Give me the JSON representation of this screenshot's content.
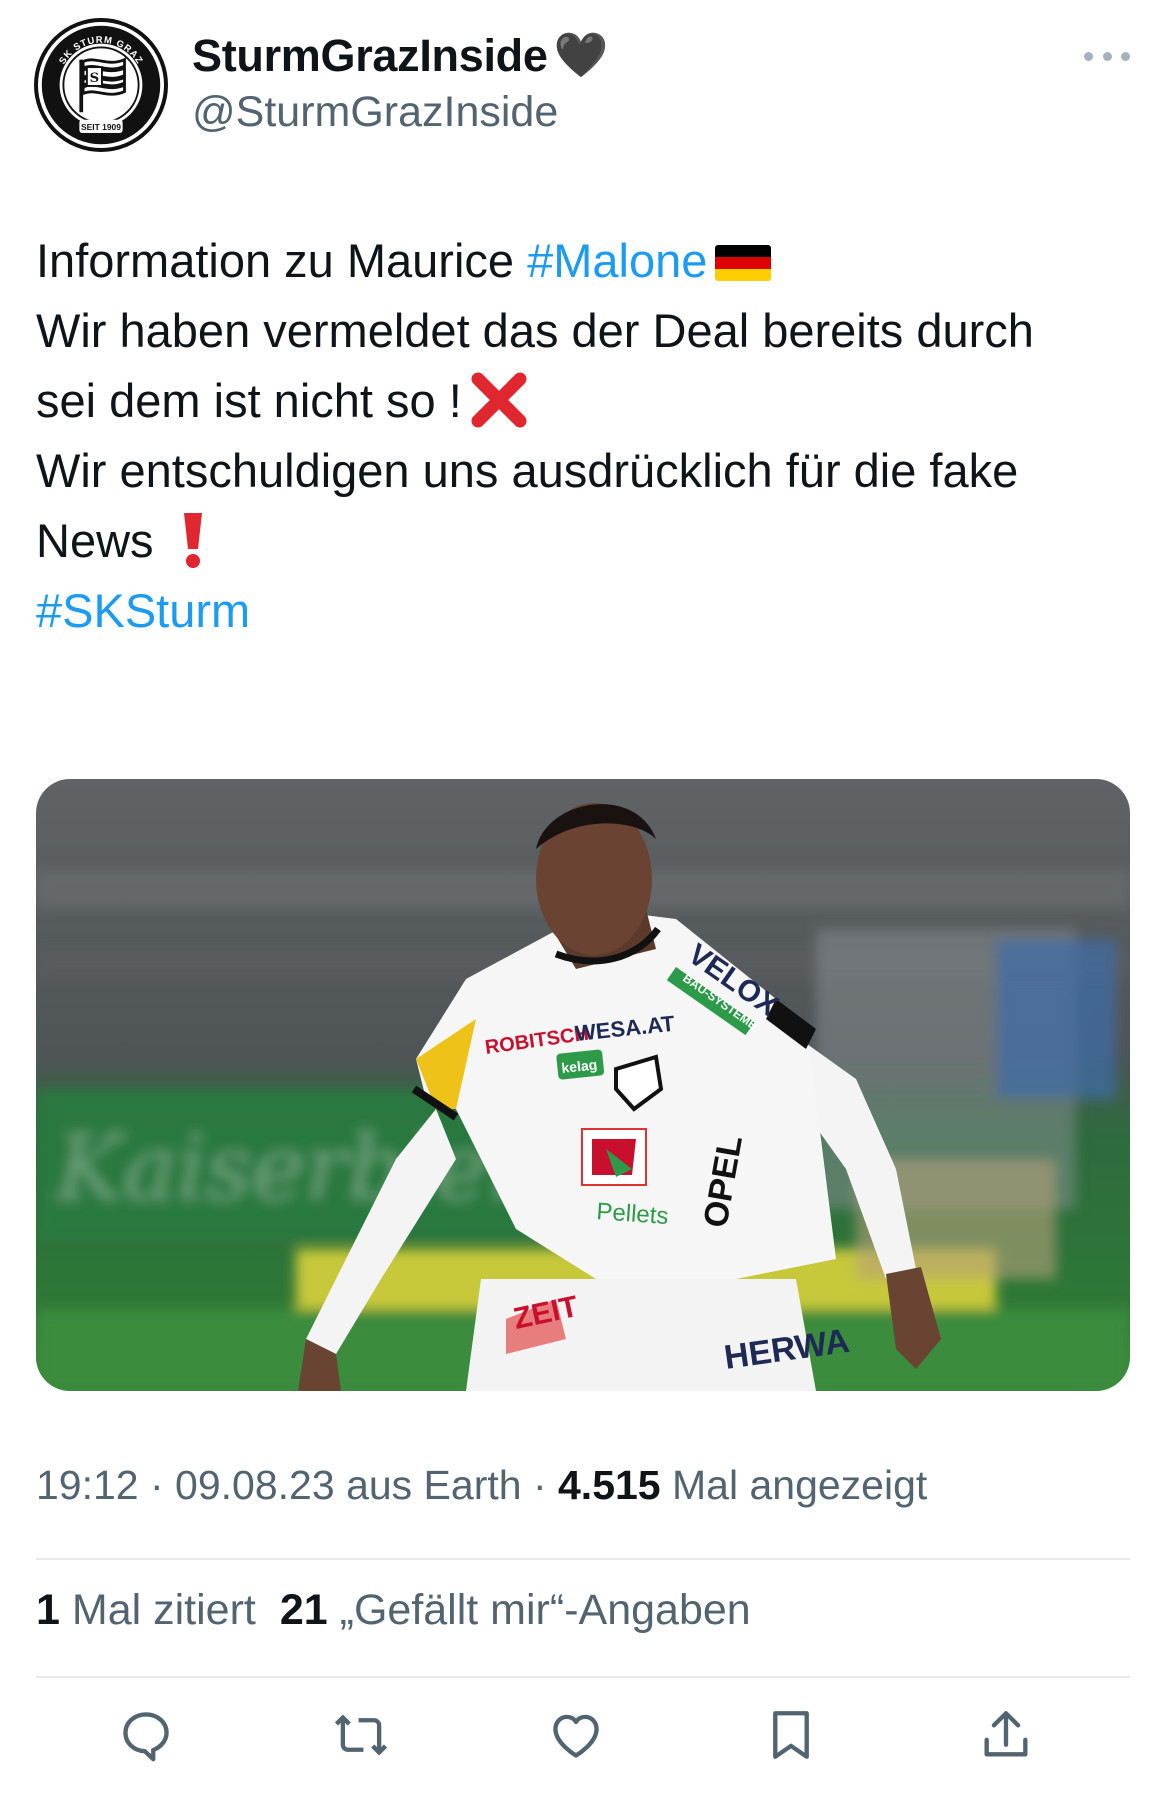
{
  "header": {
    "display_name": "SturmGrazInside",
    "name_emoji": "🖤",
    "handle": "@SturmGrazInside",
    "avatar_icon": "sk-sturm-graz-crest-icon",
    "avatar_crest_text_top": "SK STURM GRAZ",
    "avatar_crest_text_bottom": "SEIT 1909",
    "more_icon": "more-dots-icon"
  },
  "tweet": {
    "line1_text": "Information zu Maurice ",
    "line1_hashtag": "#Malone",
    "line1_emoji": "german-flag",
    "line2_text": "Wir haben vermeldet das der Deal bereits durch",
    "line3_text": "sei dem ist nicht so !",
    "line3_emoji": "cross-mark",
    "line4_text": "Wir entschuldigen uns ausdrücklich für die fake",
    "line5_text": "News",
    "line5_emoji": "exclamation-mark",
    "line6_hashtag": "#SKSturm"
  },
  "media": {
    "jersey_sponsors": [
      "ROBITSCH",
      "WESA.AT",
      "VELOX",
      "BAU-SYSTEME",
      "kelag",
      "Pellets",
      "OPEL",
      "HERWA",
      "ZEIT"
    ]
  },
  "meta": {
    "time": "19:12",
    "date": "09.08.23",
    "source": "aus Earth",
    "views_count": "4.515",
    "views_label": "Mal angezeigt",
    "separator": " · "
  },
  "stats": {
    "quotes_count": "1",
    "quotes_label": "Mal zitiert",
    "likes_count": "21",
    "likes_label": "„Gefällt mir“-Angaben"
  },
  "actions": {
    "icons": [
      "reply-icon",
      "retweet-icon",
      "like-icon",
      "bookmark-icon",
      "share-icon"
    ]
  },
  "colors": {
    "text": "#0f1419",
    "secondary": "#536471",
    "link": "#1d9bf0",
    "divider": "#e6e9ec"
  }
}
